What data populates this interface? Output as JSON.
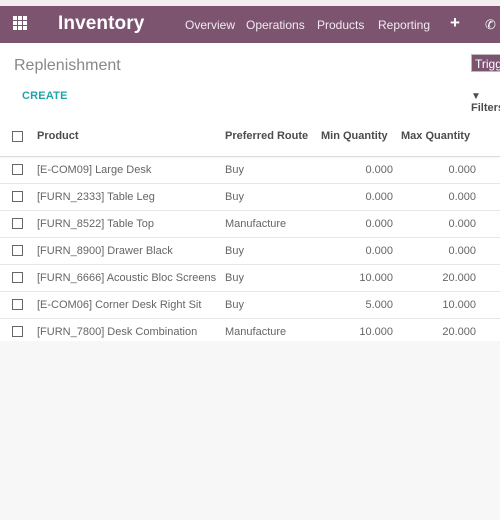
{
  "navbar": {
    "app_name": "Inventory",
    "menu": [
      "Overview",
      "Operations",
      "Products",
      "Reporting"
    ],
    "plus": "+",
    "phone": "✆",
    "color": "#7c5470"
  },
  "control_panel": {
    "title": "Replenishment",
    "create_label": "CREATE",
    "trigger_label": "Trigger",
    "filter_label": "Filters",
    "filter_icon": "▼"
  },
  "table": {
    "columns": [
      "Product",
      "Preferred Route",
      "Min Quantity",
      "Max Quantity"
    ],
    "rows": [
      {
        "product": "[E-COM09] Large Desk",
        "route": "Buy",
        "min": "0.000",
        "max": "0.000"
      },
      {
        "product": "[FURN_2333] Table Leg",
        "route": "Buy",
        "min": "0.000",
        "max": "0.000"
      },
      {
        "product": "[FURN_8522] Table Top",
        "route": "Manufacture",
        "min": "0.000",
        "max": "0.000"
      },
      {
        "product": "[FURN_8900] Drawer Black",
        "route": "Buy",
        "min": "0.000",
        "max": "0.000"
      },
      {
        "product": "[FURN_6666] Acoustic Bloc Screens",
        "route": "Buy",
        "min": "10.000",
        "max": "20.000"
      },
      {
        "product": "[E-COM06] Corner Desk Right Sit",
        "route": "Buy",
        "min": "5.000",
        "max": "10.000"
      },
      {
        "product": "[FURN_7800] Desk Combination",
        "route": "Manufacture",
        "min": "10.000",
        "max": "20.000"
      }
    ]
  }
}
